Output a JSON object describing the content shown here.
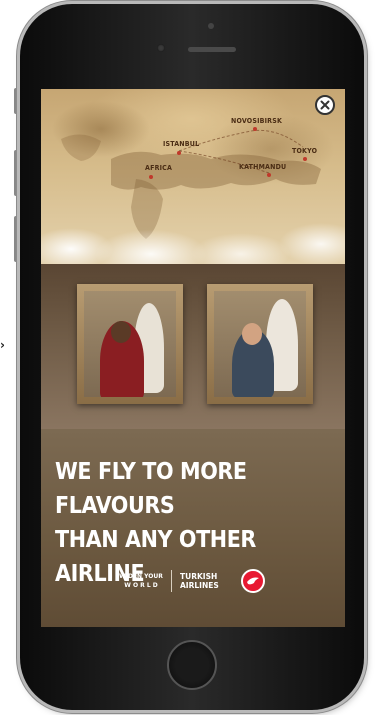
{
  "ad": {
    "cities": {
      "novosibirsk": "NOVOSIBIRSK",
      "istanbul": "ISTANBUL",
      "africa": "AFRICA",
      "kathmandu": "KATHMANDU",
      "tokyo": "TOKYO"
    },
    "headline_line1": "WE FLY TO MORE FLAVOURS",
    "headline_line2": "THAN ANY OTHER AIRLINE",
    "tagline_line1": "WIDEN YOUR",
    "tagline_line2": "W O R L D",
    "airline_line1": "TURKISH",
    "airline_line2": "AIRLINES"
  },
  "colors": {
    "brand_red": "#e81932",
    "map_marker": "#c0392b",
    "headline_bg": "#6d5a41"
  },
  "icons": {
    "close": "close-icon",
    "airline_logo": "turkish-airlines-logo"
  }
}
